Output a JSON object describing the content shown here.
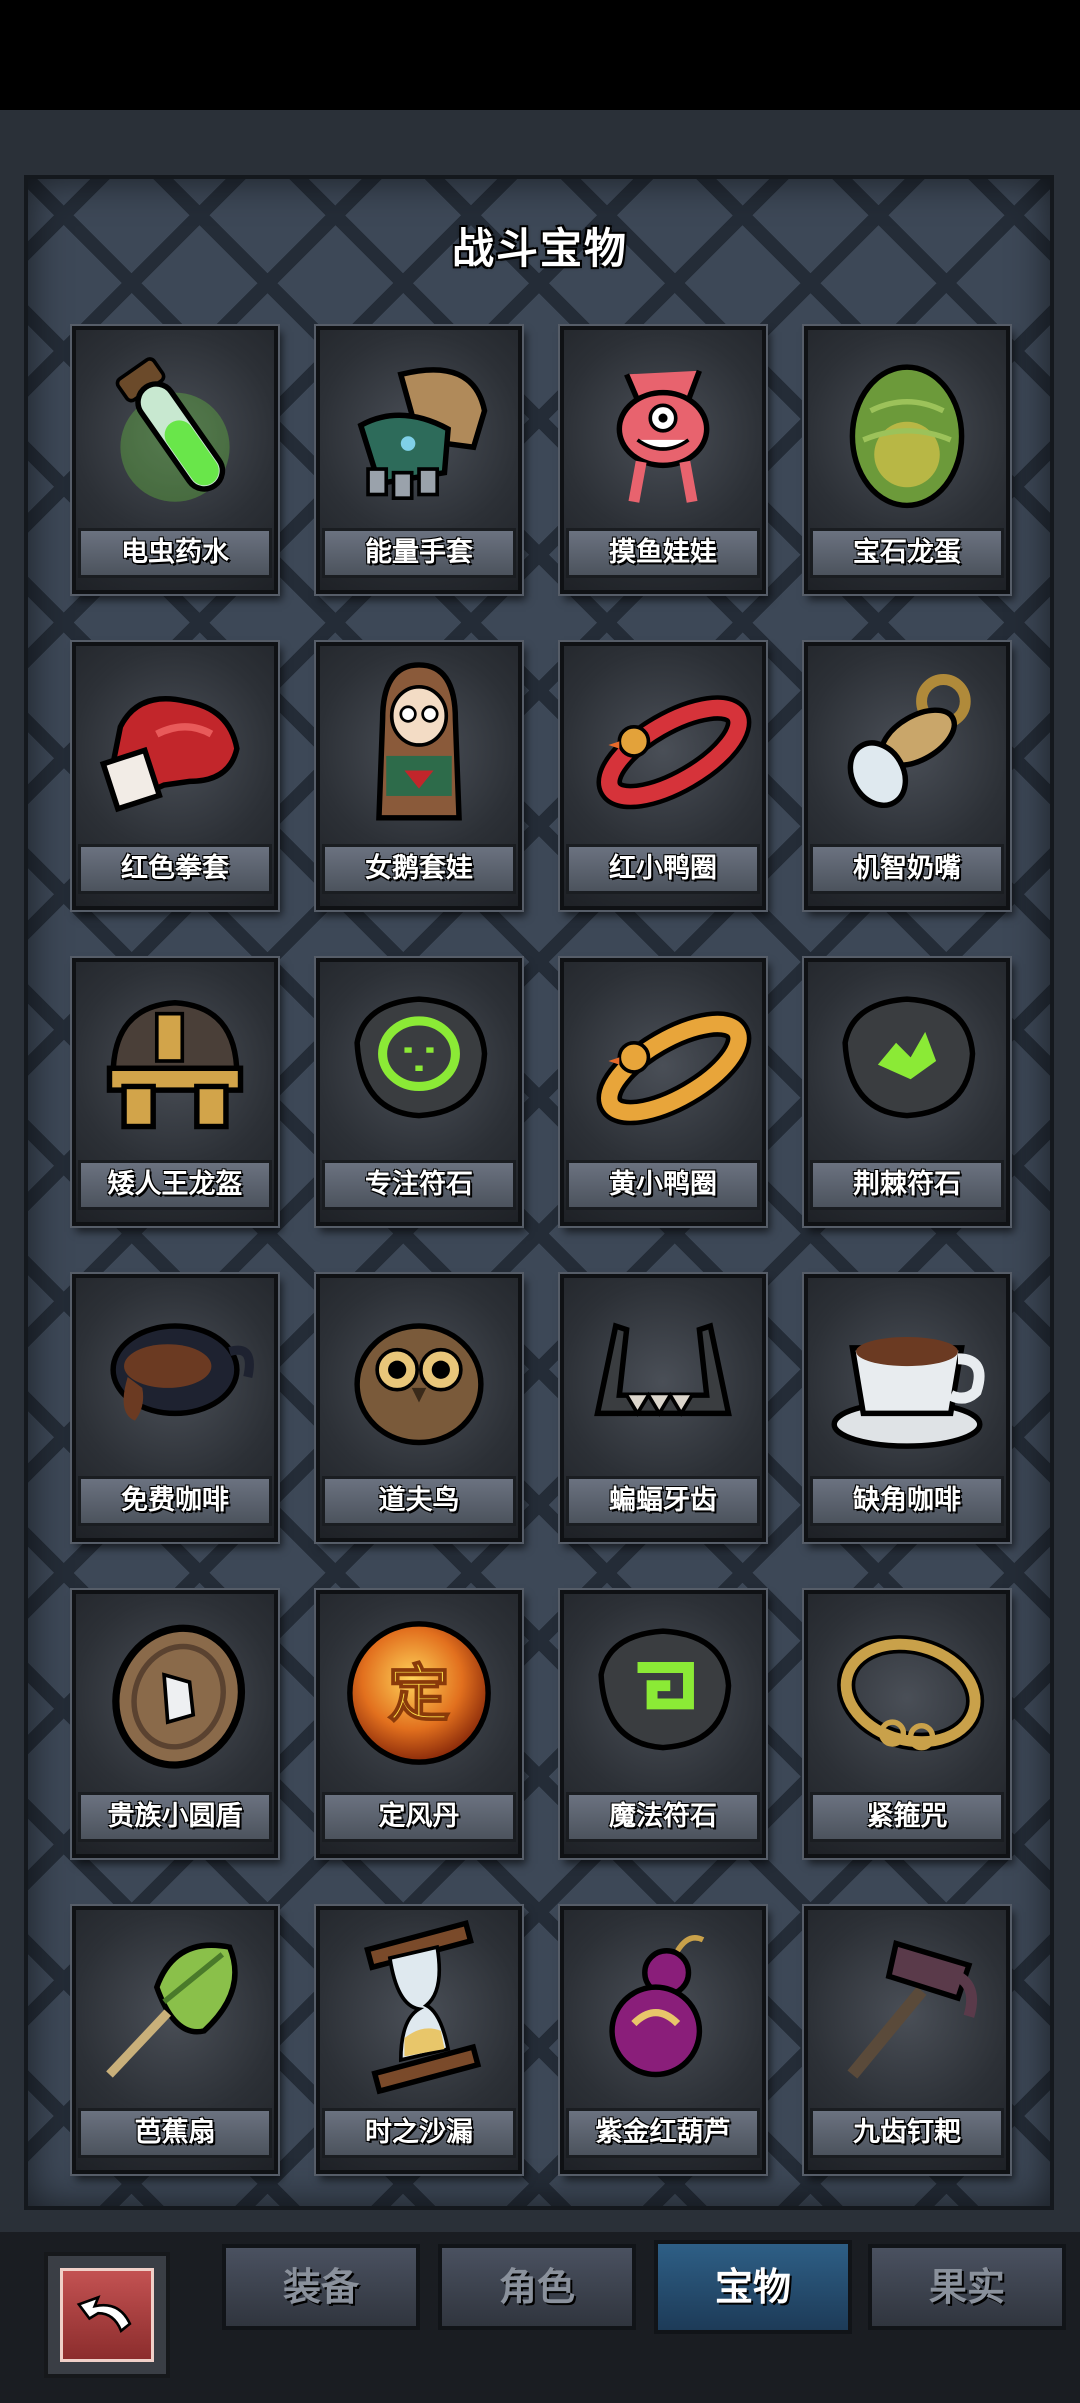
{
  "title": "战斗宝物",
  "items": [
    {
      "name": "电虫药水",
      "icon": "green-potion-vial-icon"
    },
    {
      "name": "能量手套",
      "icon": "power-glove-icon"
    },
    {
      "name": "摸鱼娃娃",
      "icon": "pink-doll-icon"
    },
    {
      "name": "宝石龙蛋",
      "icon": "gem-dragon-egg-icon"
    },
    {
      "name": "红色拳套",
      "icon": "red-boxing-glove-icon"
    },
    {
      "name": "女鹅套娃",
      "icon": "nesting-doll-icon"
    },
    {
      "name": "红小鸭圈",
      "icon": "red-duck-ring-icon"
    },
    {
      "name": "机智奶嘴",
      "icon": "pacifier-icon"
    },
    {
      "name": "矮人王龙盔",
      "icon": "dwarf-helmet-icon"
    },
    {
      "name": "专注符石",
      "icon": "focus-rune-stone-icon"
    },
    {
      "name": "黄小鸭圈",
      "icon": "yellow-duck-ring-icon"
    },
    {
      "name": "荆棘符石",
      "icon": "thorn-rune-stone-icon"
    },
    {
      "name": "免费咖啡",
      "icon": "coffee-pot-icon"
    },
    {
      "name": "道夫鸟",
      "icon": "owl-icon"
    },
    {
      "name": "蝙蝠牙齿",
      "icon": "bat-teeth-icon"
    },
    {
      "name": "缺角咖啡",
      "icon": "chipped-coffee-cup-icon"
    },
    {
      "name": "贵族小圆盾",
      "icon": "round-shield-icon"
    },
    {
      "name": "定风丹",
      "icon": "orb-icon"
    },
    {
      "name": "魔法符石",
      "icon": "magic-rune-stone-icon"
    },
    {
      "name": "紧箍咒",
      "icon": "golden-headband-icon"
    },
    {
      "name": "芭蕉扇",
      "icon": "leaf-fan-icon"
    },
    {
      "name": "时之沙漏",
      "icon": "hourglass-icon"
    },
    {
      "name": "紫金红葫芦",
      "icon": "purple-gourd-icon"
    },
    {
      "name": "九齿钉耙",
      "icon": "nine-tooth-rake-icon"
    }
  ],
  "orb_glyph": "定",
  "tabs": [
    {
      "label": "装备",
      "active": false
    },
    {
      "label": "角色",
      "active": false
    },
    {
      "label": "宝物",
      "active": true
    },
    {
      "label": "果实",
      "active": false
    }
  ],
  "back_button_icon": "back-arrow-icon"
}
